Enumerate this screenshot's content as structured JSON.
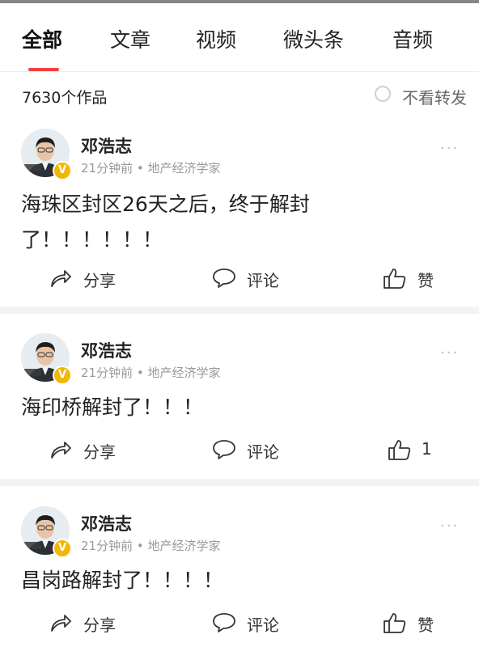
{
  "tabs": [
    {
      "label": "全部",
      "active": true
    },
    {
      "label": "文章",
      "active": false
    },
    {
      "label": "视频",
      "active": false
    },
    {
      "label": "微头条",
      "active": false
    },
    {
      "label": "音频",
      "active": false
    }
  ],
  "colors": {
    "accent": "#f04142",
    "verified": "#f2b705"
  },
  "summary": {
    "count_text": "7630个作品",
    "hide_repost_label": "不看转发",
    "hide_repost_checked": false
  },
  "posts": [
    {
      "author": "邓浩志",
      "meta": "21分钟前 • 地产经济学家",
      "content": "海珠区封区26天之后，终于解封了！！！！！！",
      "share": "分享",
      "comment": "评论",
      "like": "赞"
    },
    {
      "author": "邓浩志",
      "meta": "21分钟前 • 地产经济学家",
      "content": "海印桥解封了！！！",
      "share": "分享",
      "comment": "评论",
      "like": "1"
    },
    {
      "author": "邓浩志",
      "meta": "21分钟前 • 地产经济学家",
      "content": "昌岗路解封了！！！！",
      "share": "分享",
      "comment": "评论",
      "like": "赞"
    }
  ],
  "icons": {
    "share": "share-arrow-icon",
    "comment": "comment-bubble-icon",
    "like": "thumbs-up-icon",
    "more": "more-dots-icon",
    "verified": "verified-badge-icon"
  }
}
